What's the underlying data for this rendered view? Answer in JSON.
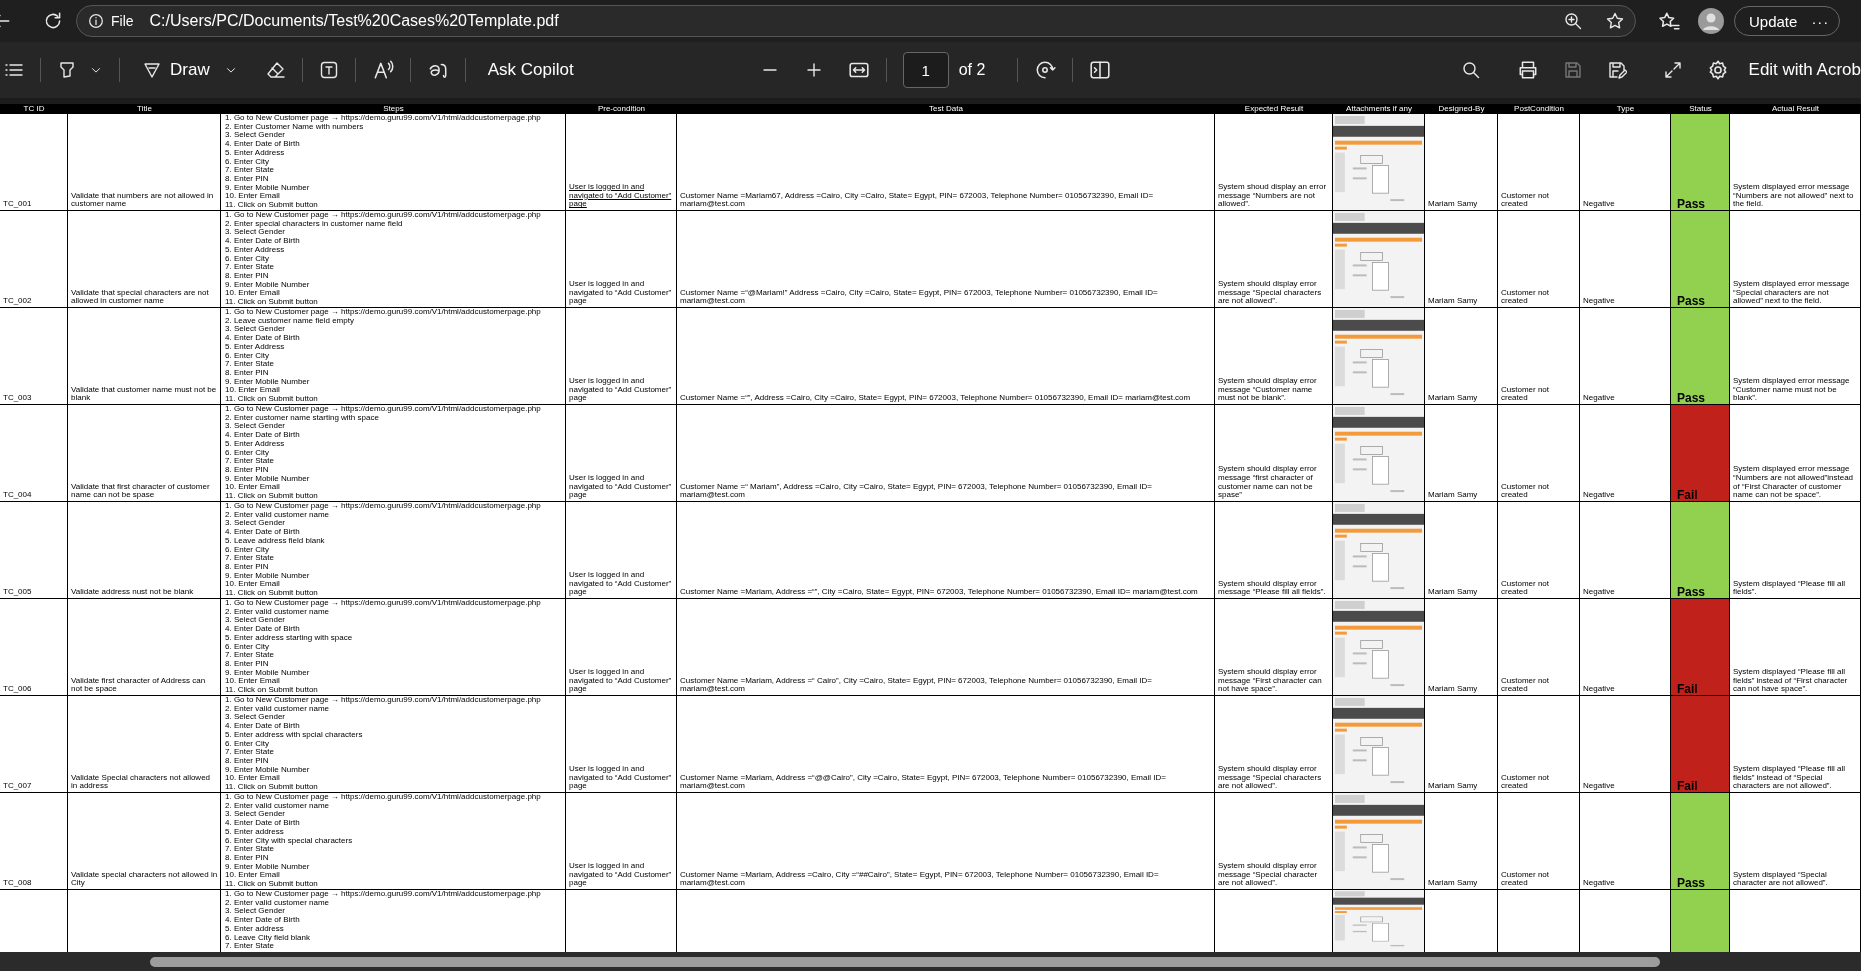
{
  "browser": {
    "address_prefix": "File",
    "url": "C:/Users/PC/Documents/Test%20Cases%20Template.pdf",
    "update_button": "Update",
    "more_button": "···"
  },
  "toolbar": {
    "draw_button": "Draw",
    "copilot_button": "Ask Copilot",
    "page_number": "1",
    "page_count": "of 2",
    "edit_button": "Edit with Acrob"
  },
  "table": {
    "columns": [
      "TC ID",
      "Title",
      "Steps",
      "Pre-condition",
      "Test Data",
      "Expected Result",
      "Attachments if any",
      "Designed-By",
      "PostCondition",
      "Type",
      "Status",
      "Actual Result"
    ],
    "rows": [
      {
        "id": "TC_001",
        "title": "Validate that numbers are not allowed in customer name",
        "steps": [
          "1. Go to New Customer page → https://demo.guru99.com/V1/html/addcustomerpage.php",
          "2. Enter Customer Name with numbers",
          "3. Select Gender",
          "4. Enter Date of Birth",
          "5. Enter Address",
          "6. Enter City",
          "7. Enter State",
          "8. Enter PIN",
          "9. Enter Mobile Number",
          "10. Enter Email",
          "11. Click on Submit button"
        ],
        "precondition": {
          "text": "User is logged in and navigated to “Add Customer” page",
          "underlined": true
        },
        "test_data": "Customer Name =Mariam67, Address =Cairo, City =Cairo, State= Egypt, PIN= 672003, Telephone Number= 01056732390, Email ID= mariam@test.com",
        "expected": "System shoud display an error message “Numbers are not allowed”.",
        "attachment": {
          "kind": "picture"
        },
        "designed_by": "Mariam Samy",
        "postcondition": "Customer not created",
        "type": "Negative",
        "status": {
          "text": "Pass",
          "color": "#92d050"
        },
        "actual": "System displayed error message “Numbers are not allowed” next to the field."
      },
      {
        "id": "TC_002",
        "title": "Validate that special characters are not allowed in customer name",
        "steps": [
          "1. Go to New Customer page → https://demo.guru99.com/V1/html/addcustomerpage.php",
          "2. Enter special characters in customer name field",
          "3. Select Gender",
          "4. Enter Date of Birth",
          "5. Enter Address",
          "6. Enter City",
          "7. Enter State",
          "8. Enter PIN",
          "9. Enter Mobile Number",
          "10. Enter Email",
          "11. Click on Submit button"
        ],
        "precondition": {
          "text": "User is logged in and navigated to “Add Customer” page",
          "underlined": false
        },
        "test_data": "Customer Name =“@Mariam!” Address =Cairo, City =Cairo, State= Egypt, PIN= 672003, Telephone Number= 01056732390, Email ID= mariam@test.com",
        "expected": "System should display error message “Special characters are not allowed”.",
        "attachment": {
          "kind": "picture"
        },
        "designed_by": "Mariam Samy",
        "postcondition": "Customer not created",
        "type": "Negative",
        "status": {
          "text": "Pass",
          "color": "#92d050"
        },
        "actual": "System displayed error message “Special characters are not allowed” next to the field."
      },
      {
        "id": "TC_003",
        "title": "Validate that customer name must not be blank",
        "steps": [
          "1. Go to New Customer page → https://demo.guru99.com/V1/html/addcustomerpage.php",
          "2. Leave customer name field empty",
          "3. Select Gender",
          "4. Enter Date of Birth",
          "5. Enter Address",
          "6. Enter City",
          "7. Enter State",
          "8. Enter PIN",
          "9. Enter Mobile Number",
          "10. Enter Email",
          "11. Click on Submit button"
        ],
        "precondition": {
          "text": "User is logged in and navigated to “Add Customer” page",
          "underlined": false
        },
        "test_data": "Customer Name =“”, Address =Cairo, City =Cairo, State= Egypt, PIN= 672003, Telephone Number= 01056732390, Email ID= mariam@test.com",
        "expected": "System should display error message “Customer name must not be blank”.",
        "attachment": {
          "kind": "picture"
        },
        "designed_by": "Mariam Samy",
        "postcondition": "Customer not created",
        "type": "Negative",
        "status": {
          "text": "Pass",
          "color": "#92d050"
        },
        "actual": "System displayed error message “Customer name must not be blank”."
      },
      {
        "id": "TC_004",
        "title": "Validate that first character of customer name can not be spase",
        "steps": [
          "1. Go to New Customer page → https://demo.guru99.com/V1/html/addcustomerpage.php",
          "2. Enter customer name starting with space",
          "3. Select Gender",
          "4. Enter Date of Birth",
          "5. Enter Address",
          "6. Enter City",
          "7. Enter State",
          "8. Enter PIN",
          "9. Enter Mobile Number",
          "10. Enter Email",
          "11. Click on Submit button"
        ],
        "precondition": {
          "text": "User is logged in and navigated to “Add Customer” page",
          "underlined": false
        },
        "test_data": "Customer Name =“ Mariam”, Address =Cairo, City =Cairo, State= Egypt, PIN= 672003, Telephone Number= 01056732390, Email ID= mariam@test.com",
        "expected": "System should display error message “first character of customer name can not be spase”",
        "attachment": {
          "kind": "picture"
        },
        "designed_by": "Mariam Samy",
        "postcondition": "Customer not created",
        "type": "Negative",
        "status": {
          "text": "Fail",
          "color": "#c0211a"
        },
        "actual": "System displayed error message “Numbers are not allowed”instead of “First Character of customer name can not be space”."
      },
      {
        "id": "TC_005",
        "title": "Validate address nust not be blank",
        "steps": [
          "1. Go to New Customer page → https://demo.guru99.com/V1/html/addcustomerpage.php",
          "2. Enter valid customer name",
          "3. Select Gender",
          "4. Enter Date of Birth",
          "5. Leave address field blank",
          "6. Enter City",
          "7. Enter State",
          "8. Enter PIN",
          "9. Enter Mobile Number",
          "10. Enter Email",
          "11. Click on Submit button"
        ],
        "precondition": {
          "text": "User is logged in and navigated to “Add Customer” page",
          "underlined": false
        },
        "test_data": "Customer Name =Mariam, Address =“”, City =Cairo, State= Egypt, PIN= 672003, Telephone Number= 01056732390, Email ID= mariam@test.com",
        "expected": "System should display error message “Please fill all fields”.",
        "attachment": {
          "kind": "picture"
        },
        "designed_by": "Mariam Samy",
        "postcondition": "Customer not created",
        "type": "Negative",
        "status": {
          "text": "Pass",
          "color": "#92d050"
        },
        "actual": "System displayed “Please fill all fields”."
      },
      {
        "id": "TC_006",
        "title": "Validate first character of Address can not be space",
        "steps": [
          "1. Go to New Customer page → https://demo.guru99.com/V1/html/addcustomerpage.php",
          "2. Enter valid customer name",
          "3. Select Gender",
          "4. Enter Date of Birth",
          "5. Enter address starting with space",
          "6. Enter City",
          "7. Enter State",
          "8. Enter PIN",
          "9. Enter Mobile Number",
          "10. Enter Email",
          "11. Click on Submit button"
        ],
        "precondition": {
          "text": "User is logged in and navigated to “Add Customer” page",
          "underlined": false
        },
        "test_data": "Customer Name =Mariam, Address =“ Cairo”, City =Cairo, State= Egypt, PIN= 672003, Telephone Number= 01056732390, Email ID= mariam@test.com",
        "expected": "System should display error message “First character can not have space”.",
        "attachment": {
          "kind": "picture"
        },
        "designed_by": "Mariam Samy",
        "postcondition": "Customer not created",
        "type": "Negative",
        "status": {
          "text": "Fail",
          "color": "#c0211a"
        },
        "actual": "System displayed “Please fill all fields” instead of “First character can not have space”."
      },
      {
        "id": "TC_007",
        "title": "Validate Special characters not allowed in address",
        "steps": [
          "1. Go to New Customer page → https://demo.guru99.com/V1/html/addcustomerpage.php",
          "2. Enter valid customer name",
          "3. Select Gender",
          "4. Enter Date of Birth",
          "5. Enter address with spcial characters",
          "6. Enter City",
          "7. Enter State",
          "8. Enter PIN",
          "9. Enter Mobile Number",
          "10. Enter Email",
          "11. Click on Submit button"
        ],
        "precondition": {
          "text": "User is logged in and navigated to “Add Customer” page",
          "underlined": false
        },
        "test_data": "Customer Name =Mariam, Address =“@@Cairo”, City =Cairo, State= Egypt, PIN= 672003, Telephone Number= 01056732390, Email ID= mariam@test.com",
        "expected": "System should display error message “Special characters are not allowed”.",
        "attachment": {
          "kind": "picture"
        },
        "designed_by": "Mariam Samy",
        "postcondition": "Customer not created",
        "type": "Negative",
        "status": {
          "text": "Fail",
          "color": "#c0211a"
        },
        "actual": "System displayed “Please fill all fields” instead of “Special characters are not allowed”."
      },
      {
        "id": "TC_008",
        "title": "Validate special characters not allowed in City",
        "steps": [
          "1. Go to New Customer page → https://demo.guru99.com/V1/html/addcustomerpage.php",
          "2. Enter valid customer name",
          "3. Select Gender",
          "4. Enter Date of Birth",
          "5. Enter address",
          "6. Enter City with special characters",
          "7. Enter State",
          "8. Enter PIN",
          "9. Enter Mobile Number",
          "10. Enter Email",
          "11. Click on Submit button"
        ],
        "precondition": {
          "text": "User is logged in and navigated to “Add Customer” page",
          "underlined": false
        },
        "test_data": "Customer Name =Mariam, Address =Cairo, City =“##Cairo”, State= Egypt, PIN= 672003, Telephone Number= 01056732390, Email ID= mariam@test.com",
        "expected": "System should display error message “Special character are not allowed”.",
        "attachment": {
          "kind": "picture"
        },
        "designed_by": "Mariam Samy",
        "postcondition": "Customer not created",
        "type": "Negative",
        "status": {
          "text": "Pass",
          "color": "#92d050"
        },
        "actual": "System displayed “Special character are not allowed”."
      },
      {
        "steps": [
          "1. Go to New Customer page → https://demo.guru99.com/V1/html/addcustomerpage.php",
          "2. Enter valid customer name",
          "3. Select Gender",
          "4. Enter Date of Birth",
          "5. Enter address",
          "6. Leave City field blank",
          "7. Enter State"
        ],
        "attachment": {
          "kind": "picture"
        },
        "status": {
          "color": "#92d050"
        }
      }
    ]
  }
}
